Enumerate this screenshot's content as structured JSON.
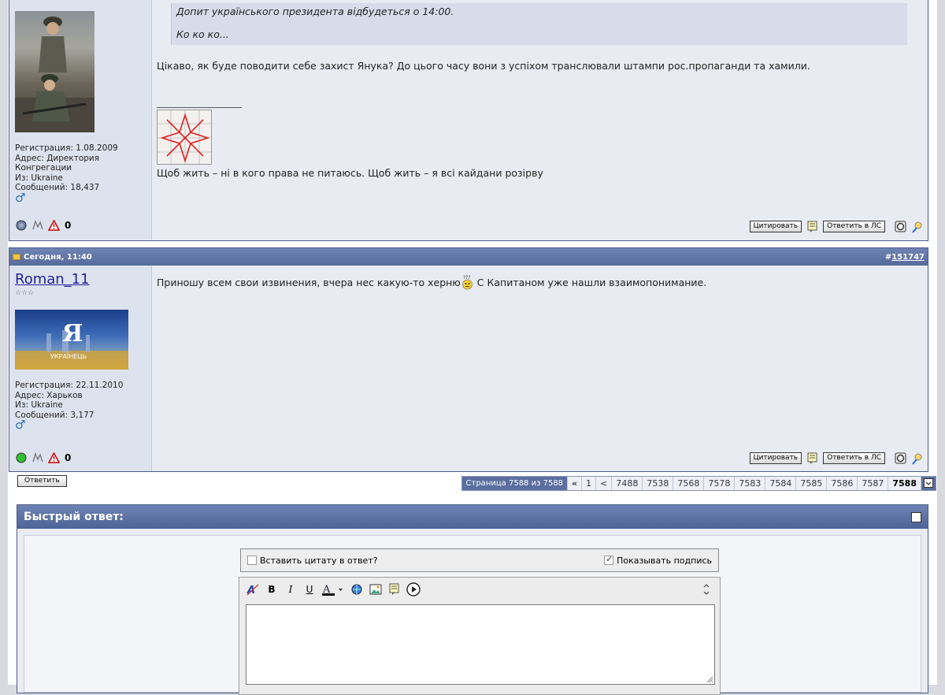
{
  "post1": {
    "quote_lines": [
      "Допит українського президента відбудеться о 14:00.",
      "Ко ко ко..."
    ],
    "message": "Цікаво, як буде поводити себе захист Янука? До цього часу вони з успіхом транслювали штампи рос.пропаганди та хамили.",
    "sig_separator": "__________________",
    "signature": "Щоб жить – ні в кого права не питаюсь. Щоб жить – я всі кайдани розірву",
    "user": {
      "reg": "Регистрация: 1.08.2009",
      "addr1": "Адрес: Директория",
      "addr2": "Конгрегации",
      "from": "Из: Ukraine",
      "posts": "Сообщений: 18,437"
    }
  },
  "post2": {
    "date": "Сегодня, 11:40",
    "number_prefix": "#",
    "number": "151747",
    "username": "Roman_11",
    "stars": "☆☆☆",
    "message_a": "Приношу всем свои извинения, вчера нес какую-то херню",
    "message_b": " С Капитаном уже нашли взаимопонимание.",
    "user": {
      "reg": "Регистрация: 22.11.2010",
      "addr": "Адрес: Харьков",
      "from": "Из: Ukraine",
      "posts": "Сообщений: 3,177"
    },
    "avatar_text": "Я",
    "avatar_sub": "УКРАЇНЕЦЬ"
  },
  "buttons": {
    "quote": "Цитировать",
    "reply_pm": "Ответить в ЛС",
    "reply": "Ответить"
  },
  "gender_symbol": "♂",
  "paperclip": "0",
  "pagination": {
    "label": "Страница 7588 из 7588",
    "first": "«",
    "pages": [
      "1",
      "<",
      "7488",
      "7538",
      "7568",
      "7578",
      "7583",
      "7584",
      "7585",
      "7586",
      "7587"
    ],
    "current": "7588"
  },
  "quick_reply": {
    "title": "Быстрый ответ:",
    "insert_quote": "Вставить цитату в ответ?",
    "show_sig": "Показывать подпись"
  },
  "colors": {
    "header_blue": "#566b9c",
    "post_bg": "#e8ebf2",
    "user_bg": "#dde3ee",
    "username_link": "#22229c"
  }
}
